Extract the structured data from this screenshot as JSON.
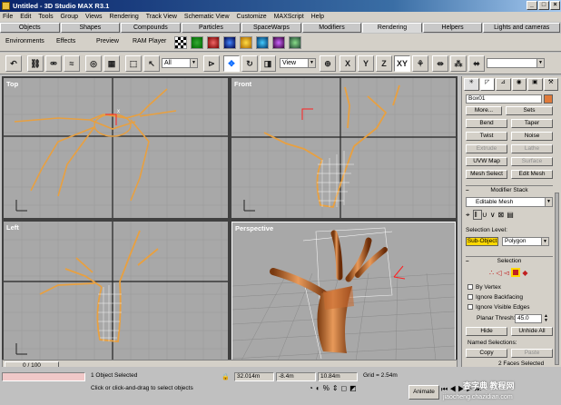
{
  "window": {
    "title": "Untitled - 3D Studio MAX R3.1"
  },
  "menu": [
    "File",
    "Edit",
    "Tools",
    "Group",
    "Views",
    "Rendering",
    "Track View",
    "Schematic View",
    "Customize",
    "MAXScript",
    "Help"
  ],
  "tabs": [
    {
      "label": "Objects"
    },
    {
      "label": "Shapes"
    },
    {
      "label": "Compounds"
    },
    {
      "label": "Particles"
    },
    {
      "label": "SpaceWarps"
    },
    {
      "label": "Modifiers"
    },
    {
      "label": "Rendering",
      "active": true
    },
    {
      "label": "Helpers"
    },
    {
      "label": "Lights and cameras"
    }
  ],
  "tab_toolbar": {
    "environments": "Environments",
    "effects": "Effects",
    "preview": "Preview",
    "ram_player": "RAM Player"
  },
  "main_toolbar": {
    "selection_filter": "All",
    "reference_coord": "View",
    "axis_x": "X",
    "axis_y": "Y",
    "axis_z": "Z",
    "axis_xy": "XY"
  },
  "viewports": {
    "top": "Top",
    "front": "Front",
    "left": "Left",
    "perspective": "Perspective"
  },
  "command_panel": {
    "object_name": "Box01",
    "more": "More...",
    "sets": "Sets",
    "modifiers": [
      "Bend",
      "Taper",
      "Twist",
      "Noise",
      "Extrude",
      "Lathe",
      "UVW Map",
      "Surface",
      "Mesh Select",
      "Edit Mesh"
    ],
    "modifier_stack_title": "Modifier Stack",
    "stack_value": "Editable Mesh",
    "selection_level_label": "Selection Level:",
    "sub_object": "Sub-Object",
    "sub_object_value": "Polygon",
    "selection_title": "Selection",
    "by_vertex": "By Vertex",
    "ignore_backfacing": "Ignore Backfacing",
    "ignore_visible_edges": "Ignore Visible Edges",
    "planar_thresh_label": "Planar Thresh:",
    "planar_thresh_value": "45.0",
    "hide": "Hide",
    "unhide_all": "Unhide All",
    "named_selections": "Named Selections:",
    "copy": "Copy",
    "paste": "Paste",
    "faces_selected": "2 Faces Selected"
  },
  "status": {
    "frame_range": "0 / 100",
    "selected": "1 Object Selected",
    "prompt": "Click or click-and-drag to select objects",
    "x_value": "32.014m",
    "y_value": "-8.4m",
    "z_value": "10.84m",
    "grid": "Grid = 2.54m",
    "animate": "Animate"
  },
  "watermark": {
    "site": "jiaocheng.chazidian.com",
    "text": "查字典 教程网"
  }
}
